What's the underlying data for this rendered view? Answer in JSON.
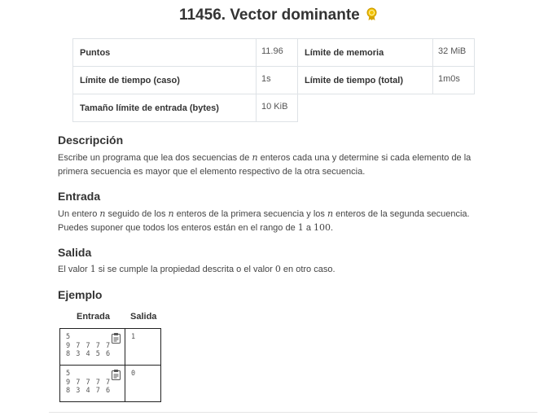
{
  "problem": {
    "title": "11456. Vector dominante",
    "badge_icon": "award-medal-icon",
    "badge_color": "#e0b400"
  },
  "info": {
    "puntos_label": "Puntos",
    "puntos_value": "11.96",
    "memoria_label": "Límite de memoria",
    "memoria_value": "32 MiB",
    "tiempo_caso_label": "Límite de tiempo (caso)",
    "tiempo_caso_value": "1s",
    "tiempo_total_label": "Límite de tiempo (total)",
    "tiempo_total_value": "1m0s",
    "entrada_label": "Tamaño límite de entrada (bytes)",
    "entrada_value": "10 KiB"
  },
  "descripcion": {
    "heading": "Descripción",
    "t1": "Escribe un programa que lea dos secuencias de ",
    "var_n": "n",
    "t2": " enteros cada una y determine si cada elemento de la primera secuencia es mayor que el elemento respectivo de la otra secuencia."
  },
  "entrada": {
    "heading": "Entrada",
    "t1": "Un entero ",
    "var_n": "n",
    "t2": " seguido de los ",
    "t3": " enteros de la primera secuencia y los ",
    "t4": " enteros de la segunda secuencia. Puedes suponer que todos los enteros están en el rango de ",
    "min": "1",
    "t5": " a ",
    "max": "100",
    "t6": "."
  },
  "salida": {
    "heading": "Salida",
    "t1": "El valor ",
    "v1": "1",
    "t2": " si se cumple la propiedad descrita o el valor ",
    "v0": "0",
    "t3": " en otro caso."
  },
  "ejemplo": {
    "heading": "Ejemplo",
    "col_entrada": "Entrada",
    "col_salida": "Salida",
    "copy_icon": "clipboard-icon",
    "cases": [
      {
        "input": "5\n9 7 7 7 7\n8 3 4 5 6",
        "output": "1"
      },
      {
        "input": "5\n9 7 7 7 7\n8 3 4 7 6",
        "output": "0"
      }
    ]
  }
}
